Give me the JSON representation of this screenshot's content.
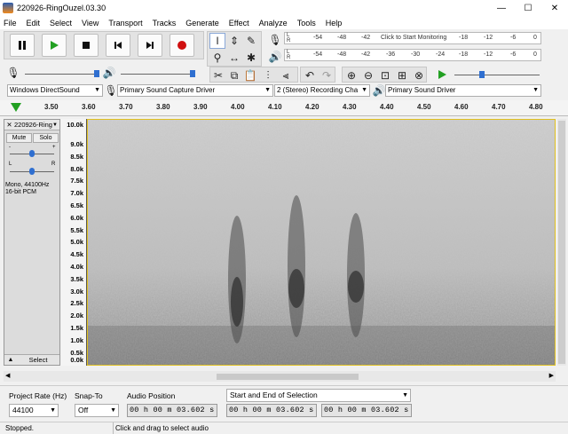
{
  "window": {
    "title": "220926-RingOuzel.03.30",
    "minimize": "—",
    "maximize": "☐",
    "close": "✕"
  },
  "menu": [
    "File",
    "Edit",
    "Select",
    "View",
    "Transport",
    "Tracks",
    "Generate",
    "Effect",
    "Analyze",
    "Tools",
    "Help"
  ],
  "meters": {
    "record_scale": [
      "-54",
      "-48",
      "-42",
      "Click to Start Monitoring",
      "-18",
      "-12",
      "-6",
      "0"
    ],
    "play_scale": [
      "-54",
      "-48",
      "-42",
      "-36",
      "-30",
      "-24",
      "-18",
      "-12",
      "-6",
      "0"
    ],
    "channel_l": "L",
    "channel_r": "R"
  },
  "devices": {
    "host": "Windows DirectSound",
    "recording_device": "Primary Sound Capture Driver",
    "channels": "2 (Stereo) Recording Cha",
    "playback_device": "Primary Sound Driver"
  },
  "ruler": {
    "ticks": [
      "3.50",
      "3.60",
      "3.70",
      "3.80",
      "3.90",
      "4.00",
      "4.10",
      "4.20",
      "4.30",
      "4.40",
      "4.50",
      "4.60",
      "4.70",
      "4.80"
    ]
  },
  "track": {
    "name": "220926-Ring",
    "mute": "Mute",
    "solo": "Solo",
    "gain_minus": "-",
    "gain_plus": "+",
    "pan_l": "L",
    "pan_r": "R",
    "info_line1": "Mono, 44100Hz",
    "info_line2": "16-bit PCM",
    "select": "Select"
  },
  "freq_scale": [
    "10.0k",
    "9.0k",
    "8.5k",
    "8.0k",
    "7.5k",
    "7.0k",
    "6.5k",
    "6.0k",
    "5.5k",
    "5.0k",
    "4.5k",
    "4.0k",
    "3.5k",
    "3.0k",
    "2.5k",
    "2.0k",
    "1.5k",
    "1.0k",
    "0.5k",
    "0.0k"
  ],
  "selection_bar": {
    "project_rate_label": "Project Rate (Hz)",
    "project_rate": "44100",
    "snap_label": "Snap-To",
    "snap": "Off",
    "audio_position_label": "Audio Position",
    "audio_position": "00 h 00 m 03.602 s",
    "selection_label": "Start and End of Selection",
    "selection_start": "00 h 00 m 03.602 s",
    "selection_end": "00 h 00 m 03.602 s"
  },
  "status": {
    "left": "Stopped.",
    "right": "Click and drag to select audio"
  },
  "colors": {
    "accent": "#2f6fd0",
    "record": "#d01010",
    "play": "#22a022",
    "selection_border": "#e0c020"
  }
}
